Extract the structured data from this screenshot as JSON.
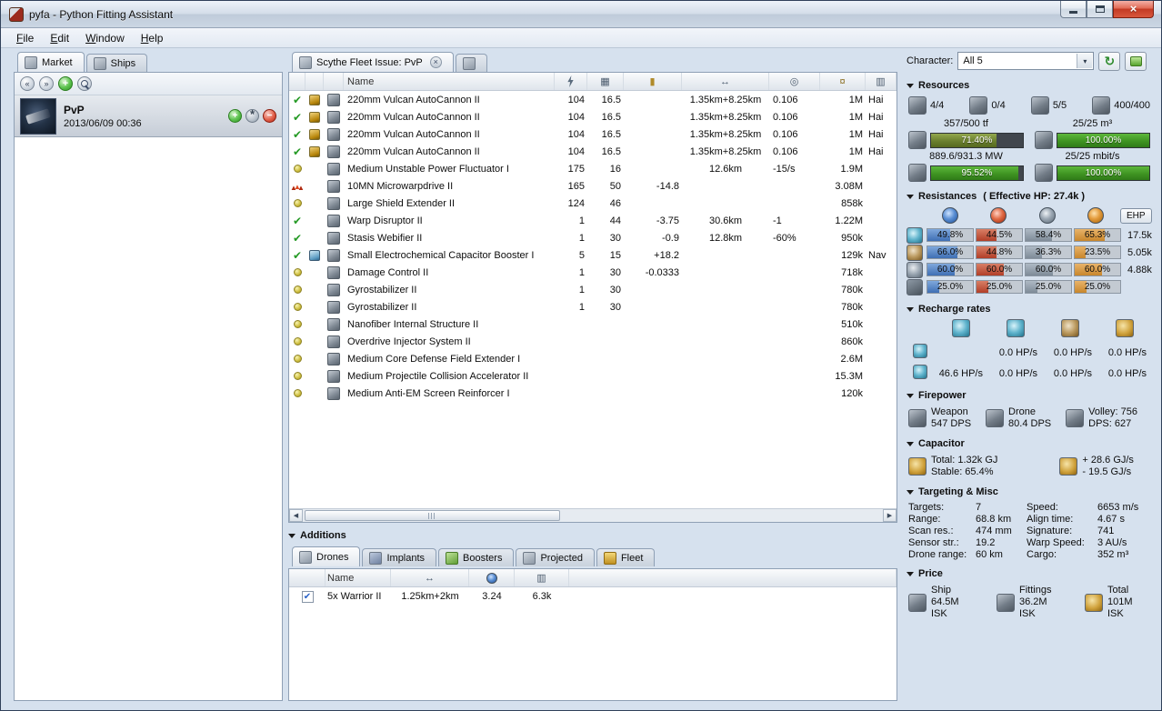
{
  "window": {
    "title": "pyfa - Python Fitting Assistant",
    "menu": [
      "File",
      "Edit",
      "Window",
      "Help"
    ]
  },
  "left_panel": {
    "tabs": [
      "Market",
      "Ships"
    ],
    "fitting": {
      "name": "PvP",
      "date": "2013/06/09 00:36"
    }
  },
  "center": {
    "tab_label": "Scythe Fleet Issue: PvP",
    "name_header": "Name",
    "modules": [
      {
        "state": "active",
        "ammo_icon": "gold",
        "name": "220mm Vulcan AutoCannon II",
        "power": "104",
        "cpu": "16.5",
        "cap": "",
        "range": "1.35km+8.25km",
        "misc": "0.106",
        "price": "1M",
        "charge": "Hai"
      },
      {
        "state": "active",
        "ammo_icon": "gold",
        "name": "220mm Vulcan AutoCannon II",
        "power": "104",
        "cpu": "16.5",
        "cap": "",
        "range": "1.35km+8.25km",
        "misc": "0.106",
        "price": "1M",
        "charge": "Hai"
      },
      {
        "state": "active",
        "ammo_icon": "gold",
        "name": "220mm Vulcan AutoCannon II",
        "power": "104",
        "cpu": "16.5",
        "cap": "",
        "range": "1.35km+8.25km",
        "misc": "0.106",
        "price": "1M",
        "charge": "Hai"
      },
      {
        "state": "active",
        "ammo_icon": "gold",
        "name": "220mm Vulcan AutoCannon II",
        "power": "104",
        "cpu": "16.5",
        "cap": "",
        "range": "1.35km+8.25km",
        "misc": "0.106",
        "price": "1M",
        "charge": "Hai"
      },
      {
        "state": "online",
        "ammo_icon": "",
        "name": "Medium Unstable Power Fluctuator I",
        "power": "175",
        "cpu": "16",
        "cap": "",
        "range": "12.6km",
        "misc": "-15/s",
        "price": "1.9M",
        "charge": ""
      },
      {
        "state": "overheated",
        "ammo_icon": "",
        "name": "10MN Microwarpdrive II",
        "power": "165",
        "cpu": "50",
        "cap": "-14.8",
        "range": "",
        "misc": "",
        "price": "3.08M",
        "charge": ""
      },
      {
        "state": "online",
        "ammo_icon": "",
        "name": "Large Shield Extender II",
        "power": "124",
        "cpu": "46",
        "cap": "",
        "range": "",
        "misc": "",
        "price": "858k",
        "charge": ""
      },
      {
        "state": "active",
        "ammo_icon": "",
        "name": "Warp Disruptor II",
        "power": "1",
        "cpu": "44",
        "cap": "-3.75",
        "range": "30.6km",
        "misc": "-1",
        "price": "1.22M",
        "charge": ""
      },
      {
        "state": "active",
        "ammo_icon": "",
        "name": "Stasis Webifier II",
        "power": "1",
        "cpu": "30",
        "cap": "-0.9",
        "range": "12.8km",
        "misc": "-60%",
        "price": "950k",
        "charge": ""
      },
      {
        "state": "active",
        "ammo_icon": "blue",
        "name": "Small Electrochemical Capacitor Booster I",
        "power": "5",
        "cpu": "15",
        "cap": "+18.2",
        "range": "",
        "misc": "",
        "price": "129k",
        "charge": "Nav"
      },
      {
        "state": "online",
        "ammo_icon": "",
        "name": "Damage Control II",
        "power": "1",
        "cpu": "30",
        "cap": "-0.0333",
        "range": "",
        "misc": "",
        "price": "718k",
        "charge": ""
      },
      {
        "state": "online",
        "ammo_icon": "",
        "name": "Gyrostabilizer II",
        "power": "1",
        "cpu": "30",
        "cap": "",
        "range": "",
        "misc": "",
        "price": "780k",
        "charge": ""
      },
      {
        "state": "online",
        "ammo_icon": "",
        "name": "Gyrostabilizer II",
        "power": "1",
        "cpu": "30",
        "cap": "",
        "range": "",
        "misc": "",
        "price": "780k",
        "charge": ""
      },
      {
        "state": "online",
        "ammo_icon": "",
        "name": "Nanofiber Internal Structure II",
        "power": "",
        "cpu": "",
        "cap": "",
        "range": "",
        "misc": "",
        "price": "510k",
        "charge": ""
      },
      {
        "state": "online",
        "ammo_icon": "",
        "name": "Overdrive Injector System II",
        "power": "",
        "cpu": "",
        "cap": "",
        "range": "",
        "misc": "",
        "price": "860k",
        "charge": ""
      },
      {
        "state": "online",
        "ammo_icon": "",
        "name": "Medium Core Defense Field Extender I",
        "power": "",
        "cpu": "",
        "cap": "",
        "range": "",
        "misc": "",
        "price": "2.6M",
        "charge": ""
      },
      {
        "state": "online",
        "ammo_icon": "",
        "name": "Medium Projectile Collision Accelerator II",
        "power": "",
        "cpu": "",
        "cap": "",
        "range": "",
        "misc": "",
        "price": "15.3M",
        "charge": ""
      },
      {
        "state": "online",
        "ammo_icon": "",
        "name": "Medium Anti-EM Screen Reinforcer I",
        "power": "",
        "cpu": "",
        "cap": "",
        "range": "",
        "misc": "",
        "price": "120k",
        "charge": ""
      }
    ]
  },
  "additions": {
    "title": "Additions",
    "tabs": [
      "Drones",
      "Implants",
      "Boosters",
      "Projected",
      "Fleet"
    ],
    "name_header": "Name",
    "drones": [
      {
        "active": true,
        "name": "5x Warrior II",
        "range": "1.25km+2km",
        "tracking": "3.24",
        "dps": "6.3k"
      }
    ]
  },
  "stats": {
    "character": {
      "label": "Character:",
      "value": "All 5"
    },
    "resources": {
      "title": "Resources",
      "turrets": "4/4",
      "launchers": "0/4",
      "drones_active": "5/5",
      "calibration": "400/400",
      "cpu_label": "357/500 tf",
      "cpu_pct": "71.40%",
      "dronebay_label": "25/25 m³",
      "dronebay_pct": "100.00%",
      "powergrid_label": "889.6/931.3 MW",
      "powergrid_pct": "95.52%",
      "bandwidth_label": "25/25 mbit/s",
      "bandwidth_pct": "100.00%"
    },
    "resistances": {
      "title": "Resistances",
      "ehp_note": "( Effective HP: 27.4k )",
      "ehp_button": "EHP",
      "rows": [
        {
          "layer": "shield",
          "em": "49.8%",
          "thermal": "44.5%",
          "kinetic": "58.4%",
          "explosive": "65.3%",
          "ehp": "17.5k"
        },
        {
          "layer": "armor",
          "em": "66.0%",
          "thermal": "44.8%",
          "kinetic": "36.3%",
          "explosive": "23.5%",
          "ehp": "5.05k"
        },
        {
          "layer": "hull",
          "em": "60.0%",
          "thermal": "60.0%",
          "kinetic": "60.0%",
          "explosive": "60.0%",
          "ehp": "4.88k"
        },
        {
          "layer": "damage-pattern",
          "em": "25.0%",
          "thermal": "25.0%",
          "kinetic": "25.0%",
          "explosive": "25.0%",
          "ehp": ""
        }
      ]
    },
    "recharge": {
      "title": "Recharge rates",
      "rows": [
        {
          "values": [
            "",
            "0.0 HP/s",
            "0.0 HP/s",
            "0.0 HP/s"
          ]
        },
        {
          "values": [
            "46.6 HP/s",
            "0.0 HP/s",
            "0.0 HP/s",
            "0.0 HP/s"
          ]
        }
      ]
    },
    "firepower": {
      "title": "Firepower",
      "weapon_label": "Weapon",
      "weapon_value": "547 DPS",
      "drone_label": "Drone",
      "drone_value": "80.4 DPS",
      "volley_label": "Volley: 756",
      "dps_label": "DPS: 627"
    },
    "capacitor": {
      "title": "Capacitor",
      "total_label": "Total: 1.32k GJ",
      "stable_label": "Stable: 65.4%",
      "peak_plus": "+ 28.6 GJ/s",
      "peak_minus": "- 19.5 GJ/s"
    },
    "targeting": {
      "title": "Targeting & Misc",
      "pairs": [
        {
          "label": "Targets:",
          "value": "7"
        },
        {
          "label": "Speed:",
          "value": "6653 m/s"
        },
        {
          "label": "Range:",
          "value": "68.8 km"
        },
        {
          "label": "Align time:",
          "value": "4.67 s"
        },
        {
          "label": "Scan res.:",
          "value": "474 mm"
        },
        {
          "label": "Signature:",
          "value": "741"
        },
        {
          "label": "Sensor str.:",
          "value": "19.2"
        },
        {
          "label": "Warp Speed:",
          "value": "3 AU/s"
        },
        {
          "label": "Drone range:",
          "value": "60 km"
        },
        {
          "label": "Cargo:",
          "value": "352 m³"
        }
      ]
    },
    "price": {
      "title": "Price",
      "ship_label": "Ship",
      "ship_value": "64.5M ISK",
      "fittings_label": "Fittings",
      "fittings_value": "36.2M ISK",
      "total_label": "Total",
      "total_value": "101M ISK"
    }
  }
}
